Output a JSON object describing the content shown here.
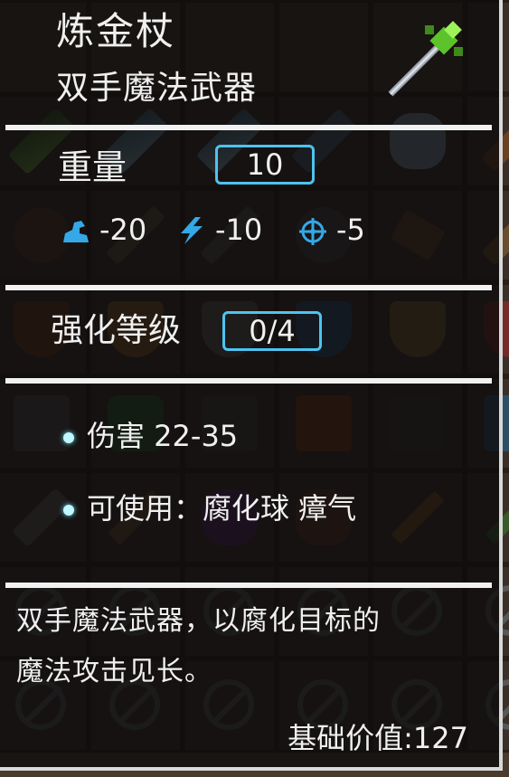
{
  "item": {
    "name": "炼金杖",
    "category": "双手魔法武器"
  },
  "weight": {
    "label": "重量",
    "value": "10"
  },
  "stat_modifiers": [
    {
      "icon": "strength-arm-icon",
      "value": "-20"
    },
    {
      "icon": "agility-lightning-icon",
      "value": "-10"
    },
    {
      "icon": "accuracy-crosshair-icon",
      "value": "-5"
    }
  ],
  "enhance": {
    "label": "强化等级",
    "value": "0/4"
  },
  "properties": {
    "damage": "伤害 22-35",
    "usable": "可使用：腐化球 瘴气"
  },
  "description": {
    "line1": "双手魔法武器，以腐化目标的",
    "line2": "魔法攻击见长。"
  },
  "base_value": "基础价值:127",
  "colors": {
    "accent": "#4ec3f0",
    "text": "#f0f0f0",
    "panel_bg": "#0c0a0a"
  }
}
